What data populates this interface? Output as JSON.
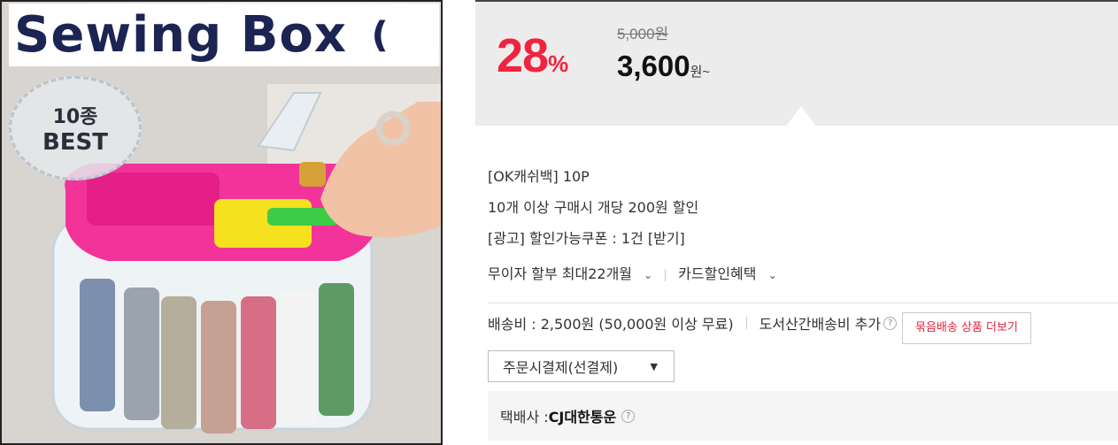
{
  "image": {
    "title": "Sewing Box",
    "seal_line1": "10종",
    "seal_line2": "BEST"
  },
  "price": {
    "discount_number": "28",
    "discount_unit": "%",
    "original": "5,000원",
    "sale_amount": "3,600",
    "sale_unit": "원~",
    "accent_color": "#f0243f"
  },
  "benefits": {
    "okcashbag": "[OK캐쉬백] 10P",
    "bulk_discount": "10개 이상 구매시 개당 200원 할인",
    "coupon": "[광고] 할인가능쿠폰 : 1건 [받기]",
    "installment": "무이자 할부 최대22개월",
    "card_discount": "카드할인혜택"
  },
  "shipping": {
    "fee": "배송비 : 2,500원 (50,000원 이상 무료)",
    "extra": "도서산간배송비 추가",
    "help_icon": "question-icon",
    "bundle_button": "묶음배송 상품 더보기",
    "payment_option": "주문시결제(선결제)",
    "courier_label": "택배사 : ",
    "courier_name": "CJ대한통운"
  }
}
